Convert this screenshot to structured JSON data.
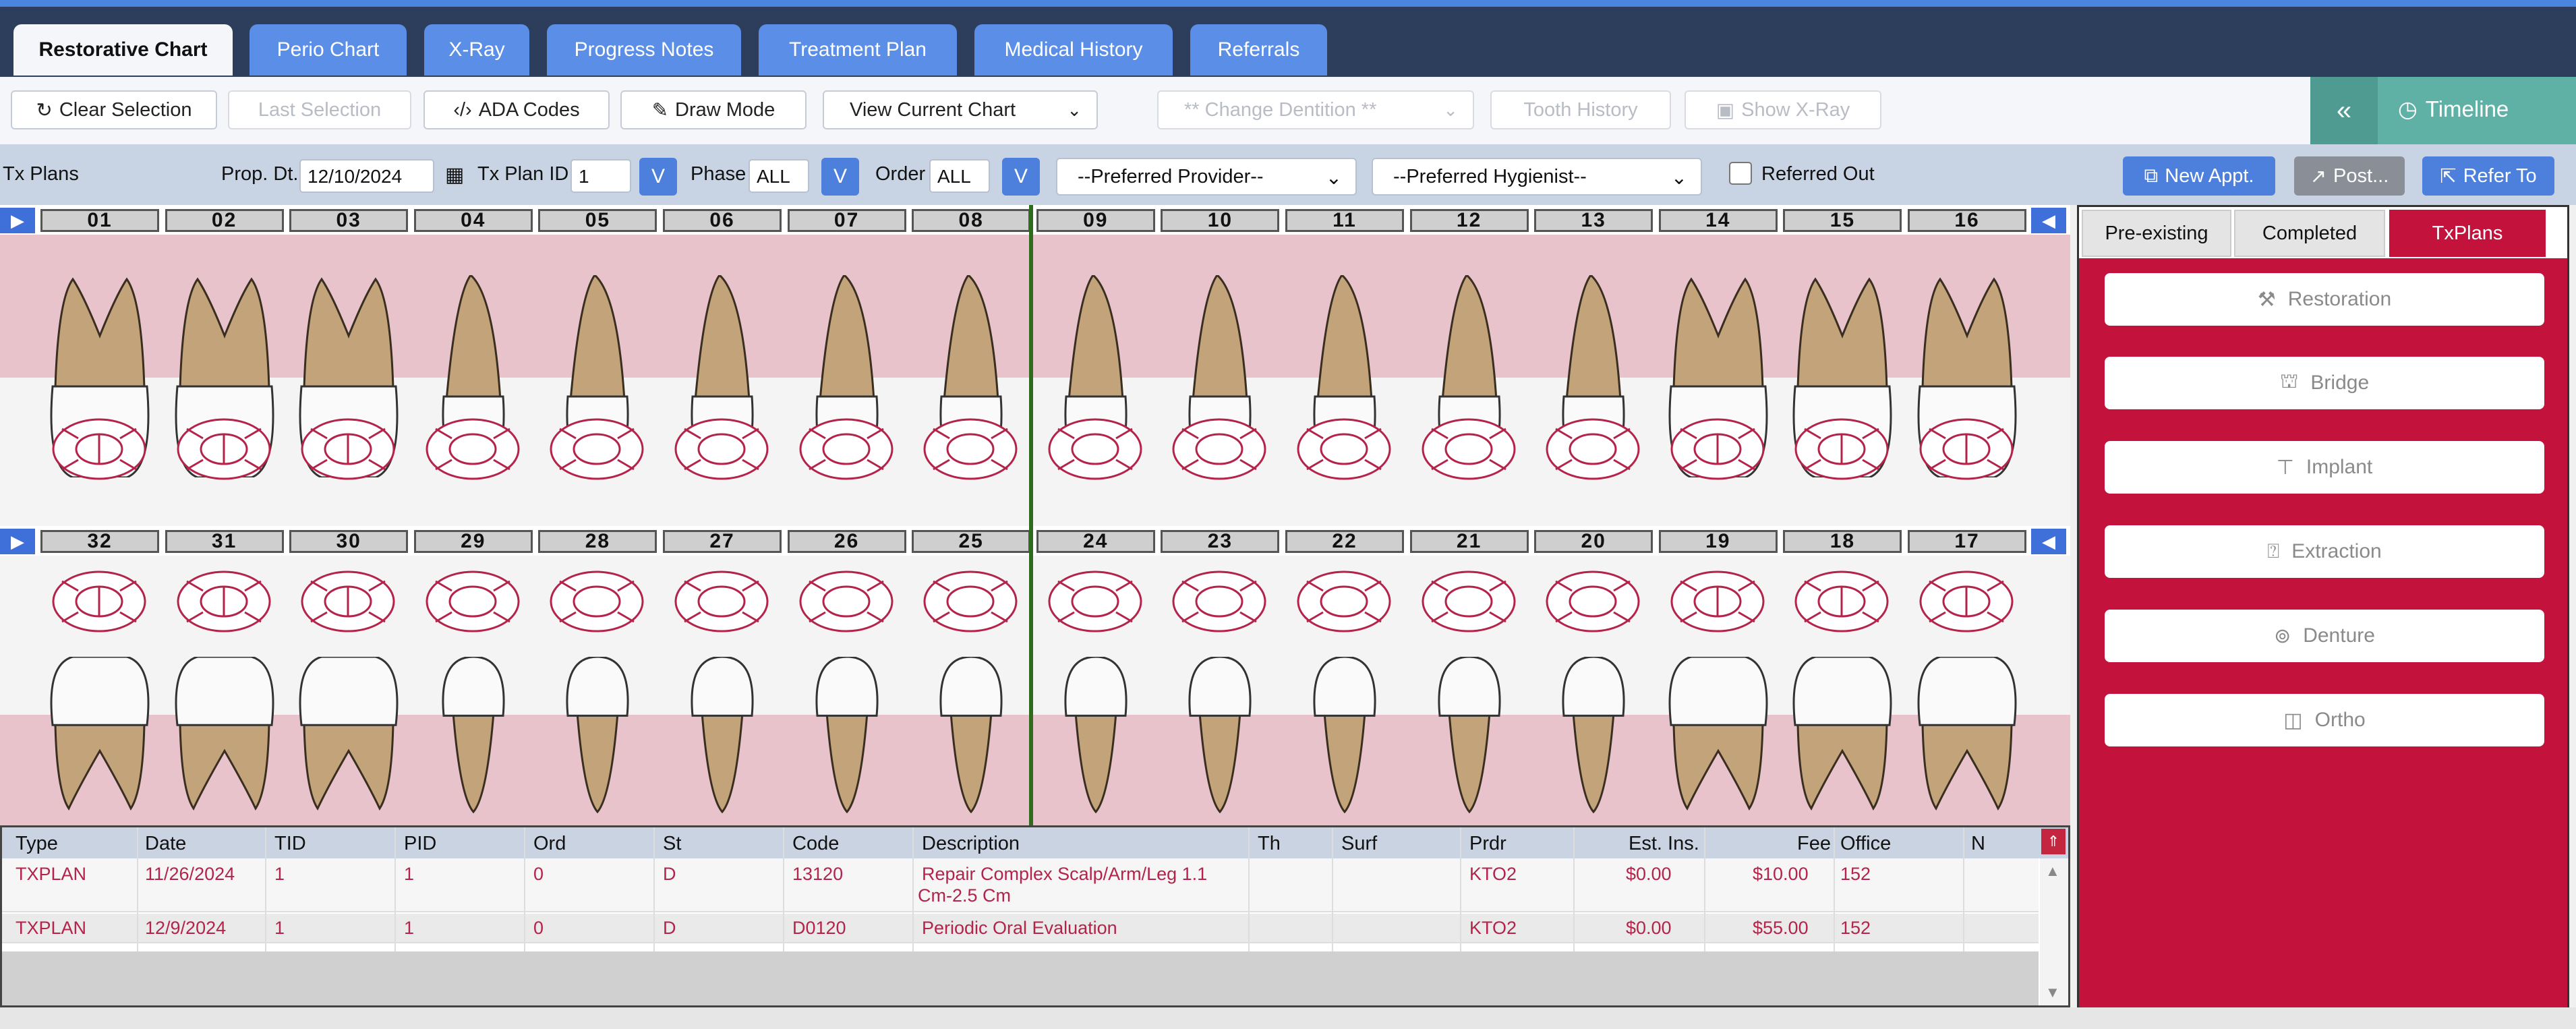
{
  "tabs": [
    "Restorative Chart",
    "Perio Chart",
    "X-Ray",
    "Progress Notes",
    "Treatment Plan",
    "Medical History",
    "Referrals"
  ],
  "toolbar": {
    "clear_selection": "Clear Selection",
    "last_selection": "Last Selection",
    "ada_codes": "ADA Codes",
    "draw_mode": "Draw Mode",
    "view_chart": "View Current Chart",
    "change_dentition": "** Change Dentition **",
    "tooth_history": "Tooth History",
    "show_xray": "Show X-Ray",
    "timeline": "Timeline"
  },
  "txbar": {
    "title": "Tx Plans",
    "prop_dt_label": "Prop. Dt.",
    "prop_dt_value": "12/10/2024",
    "plan_id_label": "Tx Plan ID",
    "plan_id_value": "1",
    "v_label": "V",
    "phase_label": "Phase",
    "phase_value": "ALL",
    "order_label": "Order",
    "order_value": "ALL",
    "provider": "--Preferred Provider--",
    "hygienist": "--Preferred Hygienist--",
    "referred_out": "Referred Out",
    "new_appt": "New Appt.",
    "post": "Post...",
    "refer_to": "Refer To"
  },
  "teeth": {
    "upper": [
      "01",
      "02",
      "03",
      "04",
      "05",
      "06",
      "07",
      "08",
      "09",
      "10",
      "11",
      "12",
      "13",
      "14",
      "15",
      "16"
    ],
    "lower": [
      "32",
      "31",
      "30",
      "29",
      "28",
      "27",
      "26",
      "25",
      "24",
      "23",
      "22",
      "21",
      "20",
      "19",
      "18",
      "17"
    ]
  },
  "grid": {
    "columns": [
      "Type",
      "Date",
      "TID",
      "PID",
      "Ord",
      "St",
      "Code",
      "Description",
      "Th",
      "Surf",
      "Prdr",
      "Est. Ins.",
      "Fee",
      "Office",
      "N"
    ],
    "rows": [
      {
        "type": "TXPLAN",
        "date": "11/26/2024",
        "tid": "1",
        "pid": "1",
        "ord": "0",
        "st": "D",
        "code": "13120",
        "desc1": "Repair Complex Scalp/Arm/Leg 1.1",
        "desc2": "Cm-2.5 Cm",
        "th": "",
        "surf": "",
        "prdr": "KTO2",
        "ins": "$0.00",
        "fee": "$10.00",
        "office": "152"
      },
      {
        "type": "TXPLAN",
        "date": "12/9/2024",
        "tid": "1",
        "pid": "1",
        "ord": "0",
        "st": "D",
        "code": "D0120",
        "desc1": "Periodic Oral Evaluation",
        "desc2": "",
        "th": "",
        "surf": "",
        "prdr": "KTO2",
        "ins": "$0.00",
        "fee": "$55.00",
        "office": "152"
      }
    ]
  },
  "rpanel": {
    "tabs": [
      "Pre-existing",
      "Completed",
      "TxPlans"
    ],
    "buttons": [
      "Restoration",
      "Bridge",
      "Implant",
      "Extraction",
      "Denture",
      "Ortho"
    ]
  },
  "colors": {
    "accent": "#5b8ee6",
    "panel": "#c3133d",
    "gum": "#e8c3cb",
    "grid_text": "#b4234a"
  }
}
